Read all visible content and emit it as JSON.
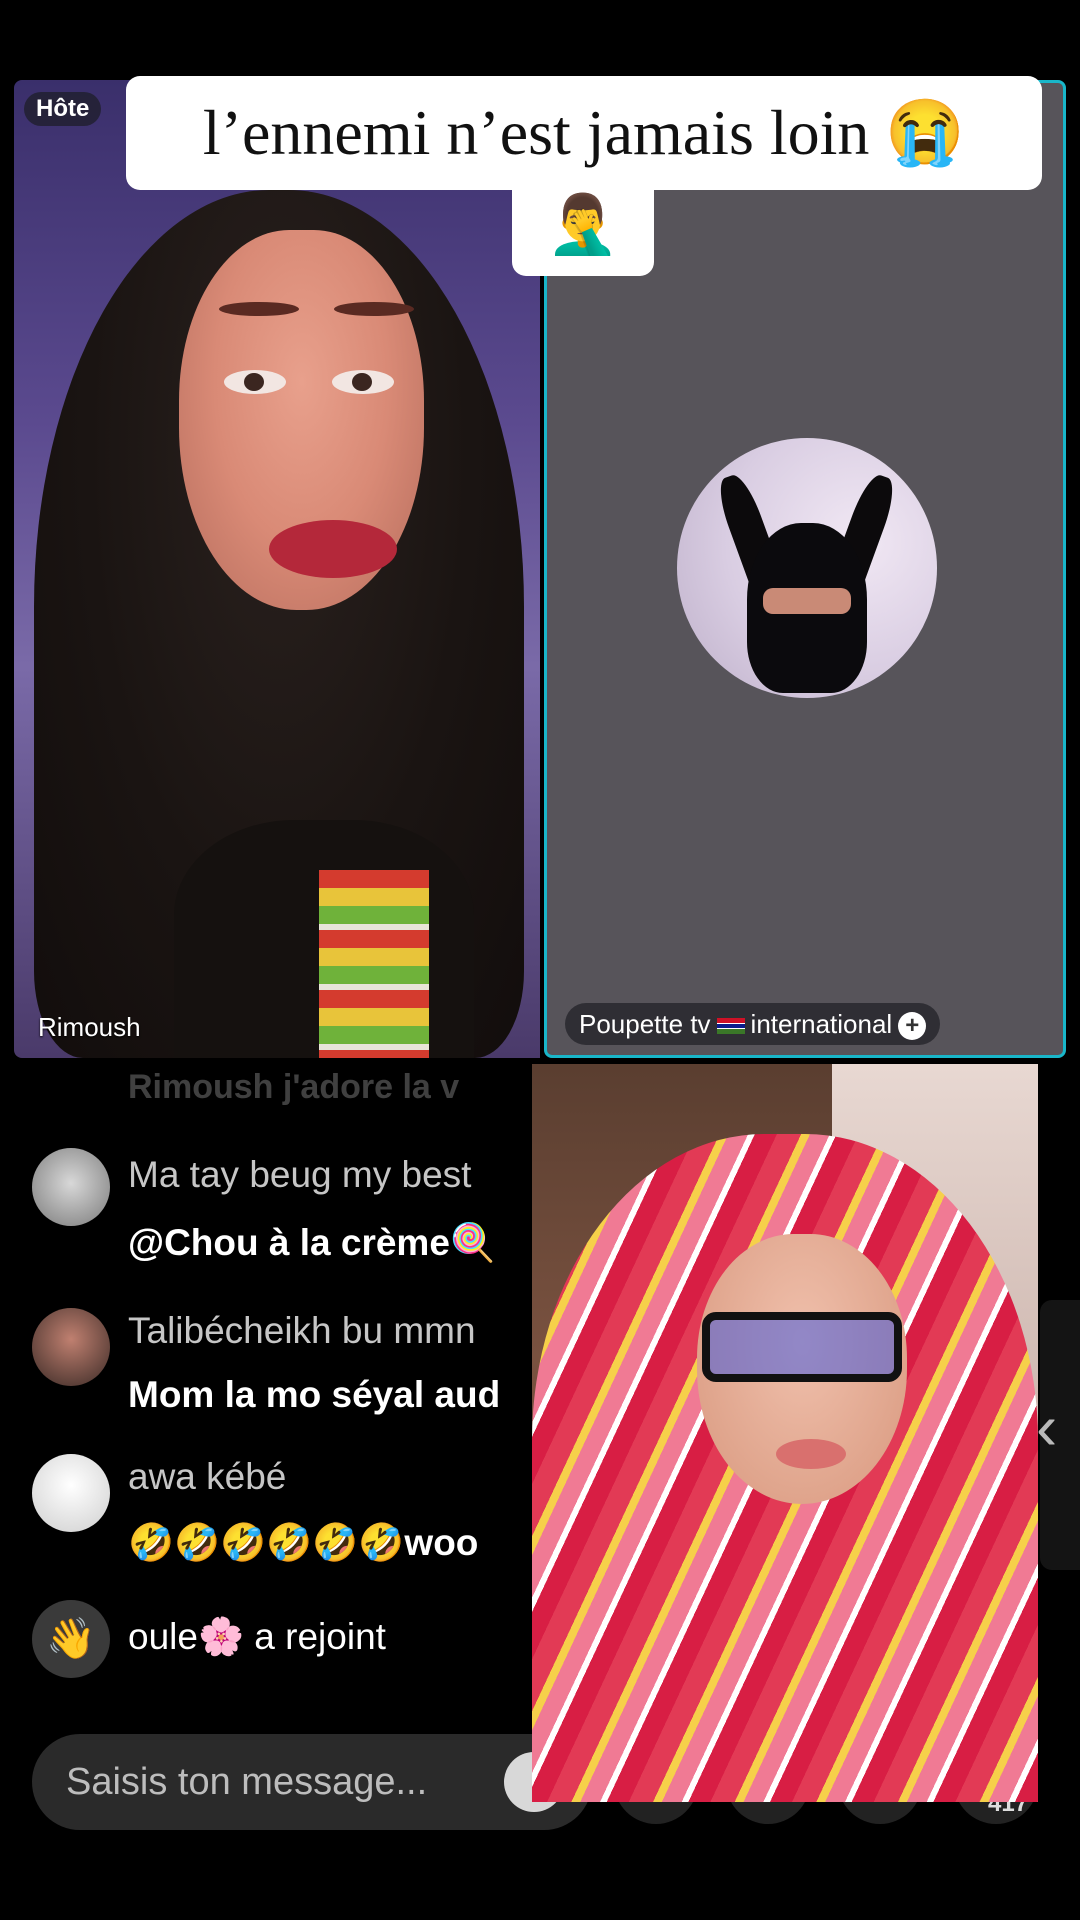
{
  "caption": {
    "line1": "l’ennemi n’est jamais loin 😭",
    "line2": "🤦‍♂️"
  },
  "host_badge": "Hôte",
  "left_guest": {
    "name": "Rimoush"
  },
  "right_guest": {
    "name_before_flag": "Poupette tv",
    "name_after_flag": "international",
    "add": "+"
  },
  "faded_comment": "Rimoush j'adore la v",
  "comments": [
    {
      "user": "Ma tay beug my best",
      "text": "@Chou à la crème🍭"
    },
    {
      "user": "Talibécheikh bu mmn",
      "text": "Mom la mo séyal aud"
    },
    {
      "user": "awa kébé",
      "text": "🤣🤣🤣🤣🤣🤣woo"
    }
  ],
  "join": {
    "icon": "👋",
    "text": "oule🌸 a rejoint"
  },
  "input": {
    "placeholder": "Saisis ton message..."
  },
  "viewer_count": "417",
  "icons": {
    "side_chevron": "‹",
    "add": "plus-icon"
  }
}
